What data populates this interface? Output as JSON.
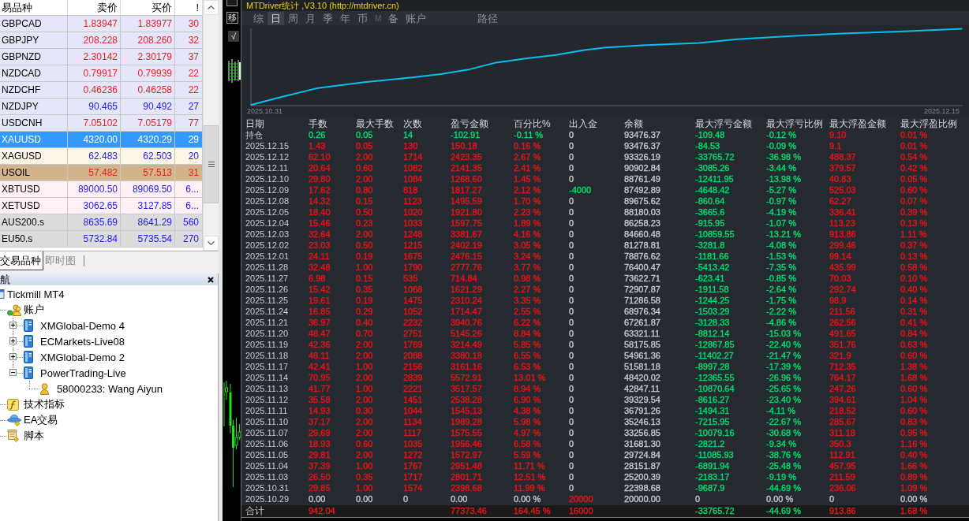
{
  "market_watch": {
    "columns": [
      "易品种",
      "卖价",
      "买价",
      "!"
    ],
    "rows": [
      {
        "symbol": "GBPCAD",
        "bid": "1.83947",
        "ask": "1.83977",
        "spread": "30",
        "rising": false,
        "color": "#e6e6fa",
        "selected": false
      },
      {
        "symbol": "GBPJPY",
        "bid": "208.228",
        "ask": "208.260",
        "spread": "32",
        "rising": false,
        "color": "#e6e6fa",
        "selected": false
      },
      {
        "symbol": "GBPNZD",
        "bid": "2.30142",
        "ask": "2.30179",
        "spread": "37",
        "rising": false,
        "color": "#e6e6fa",
        "selected": false
      },
      {
        "symbol": "NZDCAD",
        "bid": "0.79917",
        "ask": "0.79939",
        "spread": "22",
        "rising": false,
        "color": "#e6e6fa",
        "selected": false
      },
      {
        "symbol": "NZDCHF",
        "bid": "0.46236",
        "ask": "0.46258",
        "spread": "22",
        "rising": false,
        "color": "#e6e6fa",
        "selected": false
      },
      {
        "symbol": "NZDJPY",
        "bid": "90.465",
        "ask": "90.492",
        "spread": "27",
        "rising": true,
        "color": "#e6e6fa",
        "selected": false
      },
      {
        "symbol": "USDCNH",
        "bid": "7.05102",
        "ask": "7.05179",
        "spread": "77",
        "rising": false,
        "color": "#e6e6fa",
        "selected": false
      },
      {
        "symbol": "XAUUSD",
        "bid": "4320.00",
        "ask": "4320.29",
        "spread": "29",
        "selected": true
      },
      {
        "symbol": "XAGUSD",
        "bid": "62.483",
        "ask": "62.503",
        "spread": "20",
        "rising": true,
        "color": "#fdf5e6",
        "selected": false
      },
      {
        "symbol": "USOIL",
        "bid": "57.482",
        "ask": "57.513",
        "spread": "31",
        "rising": false,
        "color": "#d2b48c",
        "selected": false
      },
      {
        "symbol": "XBTUSD",
        "bid": "89000.50",
        "ask": "89069.50",
        "spread": "6...",
        "rising": true,
        "color": "#fff0f5",
        "selected": false
      },
      {
        "symbol": "XETUSD",
        "bid": "3062.65",
        "ask": "3127.85",
        "spread": "6...",
        "rising": true,
        "color": "#fff0f5",
        "selected": false
      },
      {
        "symbol": "AUS200.s",
        "bid": "8635.69",
        "ask": "8641.29",
        "spread": "560",
        "rising": true,
        "color": "#dcdcdc",
        "selected": false
      },
      {
        "symbol": "EU50.s",
        "bid": "5732.84",
        "ask": "5735.54",
        "spread": "270",
        "rising": true,
        "color": "#dcdcdc",
        "selected": false
      }
    ]
  },
  "panel_tabs": [
    {
      "label": "交易品种",
      "selected": true
    },
    {
      "label": "即时图",
      "selected": false
    }
  ],
  "navigator": {
    "title": "航",
    "tree": [
      {
        "label": "Tickmill MT4",
        "kind": "terminal",
        "children": [
          {
            "label": "账户",
            "kind": "accounts",
            "children": [
              {
                "label": "XMGlobal-Demo 4",
                "kind": "server",
                "expanded": false
              },
              {
                "label": "ECMarkets-Live08",
                "kind": "server",
                "expanded": false
              },
              {
                "label": "XMGlobal-Demo 2",
                "kind": "server",
                "expanded": false
              },
              {
                "label": "PowerTrading-Live",
                "kind": "server",
                "expanded": true,
                "children": [
                  {
                    "label": "58000233: Wang Aiyun",
                    "kind": "account"
                  }
                ]
              }
            ]
          },
          {
            "label": "技术指标",
            "kind": "indicators"
          },
          {
            "label": "EA交易",
            "kind": "experts"
          },
          {
            "label": "脚本",
            "kind": "scripts"
          }
        ]
      }
    ]
  },
  "chart_toolbar": [
    "移",
    "√"
  ],
  "stats": {
    "title": "MTDriver统计 ,V3.10 (http://mtdriver.cn)",
    "tabs": [
      {
        "label": "综",
        "selected": false,
        "disabled": false
      },
      {
        "label": "日",
        "selected": true,
        "disabled": false
      },
      {
        "label": "周",
        "selected": false,
        "disabled": false
      },
      {
        "label": "月",
        "selected": false,
        "disabled": false
      },
      {
        "label": "季",
        "selected": false,
        "disabled": false
      },
      {
        "label": "年",
        "selected": false,
        "disabled": false
      },
      {
        "label": "币",
        "selected": false,
        "disabled": false
      },
      {
        "label": "M",
        "selected": false,
        "disabled": true
      },
      {
        "label": "备",
        "selected": false,
        "disabled": false
      },
      {
        "label": "账户",
        "selected": false,
        "disabled": false
      }
    ],
    "path_button": "路径",
    "equity_chart": {
      "start_label": "2025.10.31",
      "end_label": "2025.12.15"
    },
    "table": {
      "columns": [
        {
          "label": "日期"
        },
        {
          "label": "手数",
          "color": "#f01414"
        },
        {
          "label": "最大手数",
          "color": "#f01414"
        },
        {
          "label": "次数",
          "color": "#f01414"
        },
        {
          "label": "盈亏金额",
          "color": "#f01414"
        },
        {
          "label": "百分比%",
          "color": "#f01414"
        },
        {
          "label": "出入金",
          "color": "#c4cad2"
        },
        {
          "label": "余额",
          "color": "#c4cad2"
        },
        {
          "label": "最大浮亏金额",
          "color": "#00e070"
        },
        {
          "label": "最大浮亏比例",
          "color": "#00e070"
        },
        {
          "label": "最大浮盈金额",
          "color": "#f01414"
        },
        {
          "label": "最大浮盈比例",
          "color": "#f01414"
        }
      ],
      "rows": [
        [
          "持仓",
          {
            "text": "0.26",
            "color": "#00e070"
          },
          {
            "text": "0.05",
            "color": "#00e070"
          },
          {
            "text": "14",
            "color": "#00e070"
          },
          {
            "text": "-102.91",
            "color": "#00e070"
          },
          {
            "text": "-0.11 %",
            "color": "#00e070"
          },
          "0",
          "93476.37",
          "-109.48",
          "-0.12 %",
          "9.10",
          "0.01 %"
        ],
        [
          "2025.12.15",
          "1.43",
          "0.05",
          "130",
          "150.18",
          "0.16 %",
          "0",
          "93476.37",
          "-84.53",
          "-0.09 %",
          "9.1",
          "0.01 %"
        ],
        [
          "2025.12.12",
          "62.10",
          "2.00",
          "1714",
          "2423.35",
          "2.67 %",
          "0",
          "93326.19",
          "-33765.72",
          "-36.98 %",
          "488.37",
          "0.54 %"
        ],
        [
          "2025.12.11",
          "20.64",
          "0.60",
          "1082",
          "2141.35",
          "2.41 %",
          "0",
          "90902.84",
          "-3085.26",
          "-3.44 %",
          "379.57",
          "0.42 %"
        ],
        [
          "2025.12.10",
          "29.80",
          "2.00",
          "1084",
          "1268.60",
          "1.45 %",
          "0",
          "88761.49",
          "-12411.95",
          "-13.98 %",
          "40.83",
          "0.05 %"
        ],
        [
          "2025.12.09",
          "17.62",
          "0.80",
          "818",
          "1817.27",
          "2.12 %",
          {
            "text": "-4000",
            "color": "#00e070"
          },
          "87492.89",
          "-4648.42",
          "-5.27 %",
          "525.03",
          "0.60 %"
        ],
        [
          "2025.12.08",
          "14.32",
          "0.15",
          "1123",
          "1495.59",
          "1.70 %",
          "0",
          "89675.62",
          "-860.64",
          "-0.97 %",
          "62.27",
          "0.07 %"
        ],
        [
          "2025.12.05",
          "18.40",
          "0.50",
          "1020",
          "1921.80",
          "2.23 %",
          "0",
          "88180.03",
          "-3665.6",
          "-4.19 %",
          "336.41",
          "0.39 %"
        ],
        [
          "2025.12.04",
          "15.46",
          "0.23",
          "1033",
          "1597.75",
          "1.89 %",
          "0",
          "86258.23",
          "-915.95",
          "-1.07 %",
          "113.23",
          "0.13 %"
        ],
        [
          "2025.12.03",
          "32.64",
          "2.00",
          "1248",
          "3381.67",
          "4.16 %",
          "0",
          "84660.48",
          "-10859.55",
          "-13.21 %",
          "913.86",
          "1.11 %"
        ],
        [
          "2025.12.02",
          "23.03",
          "0.50",
          "1215",
          "2402.19",
          "3.05 %",
          "0",
          "81278.81",
          "-3281.8",
          "-4.08 %",
          "299.46",
          "0.37 %"
        ],
        [
          "2025.12.01",
          "24.11",
          "0.19",
          "1675",
          "2476.15",
          "3.24 %",
          "0",
          "78876.62",
          "-1181.66",
          "-1.53 %",
          "99.14",
          "0.13 %"
        ],
        [
          "2025.11.28",
          "32.48",
          "1.00",
          "1790",
          "2777.76",
          "3.77 %",
          "0",
          "76400.47",
          "-5413.42",
          "-7.35 %",
          "435.99",
          "0.58 %"
        ],
        [
          "2025.11.27",
          "6.98",
          "0.15",
          "535",
          "714.84",
          "0.98 %",
          "0",
          "73622.71",
          "-623.41",
          "-0.85 %",
          "70.03",
          "0.10 %"
        ],
        [
          "2025.11.26",
          "15.42",
          "0.35",
          "1068",
          "1621.29",
          "2.27 %",
          "0",
          "72907.87",
          "-1911.58",
          "-2.64 %",
          "292.74",
          "0.40 %"
        ],
        [
          "2025.11.25",
          "19.61",
          "0.19",
          "1475",
          "2310.24",
          "3.35 %",
          "0",
          "71286.58",
          "-1244.25",
          "-1.75 %",
          "98.9",
          "0.14 %"
        ],
        [
          "2025.11.24",
          "16.85",
          "0.29",
          "1052",
          "1714.47",
          "2.55 %",
          "0",
          "68976.34",
          "-1503.29",
          "-2.22 %",
          "211.56",
          "0.31 %"
        ],
        [
          "2025.11.21",
          "36.97",
          "0.40",
          "2232",
          "3940.76",
          "6.22 %",
          "0",
          "67261.87",
          "-3128.33",
          "-4.86 %",
          "262.56",
          "0.41 %"
        ],
        [
          "2025.11.20",
          "48.47",
          "0.70",
          "2751",
          "5145.26",
          "8.84 %",
          "0",
          "63321.11",
          "-8812.14",
          "-15.03 %",
          "491.65",
          "0.84 %"
        ],
        [
          "2025.11.19",
          "42.36",
          "2.00",
          "1769",
          "3214.49",
          "5.85 %",
          "0",
          "58175.85",
          "-12867.85",
          "-22.40 %",
          "351.76",
          "0.63 %"
        ],
        [
          "2025.11.18",
          "48.11",
          "2.00",
          "2088",
          "3380.18",
          "6.55 %",
          "0",
          "54961.36",
          "-11402.27",
          "-21.47 %",
          "321.9",
          "0.60 %"
        ],
        [
          "2025.11.17",
          "42.41",
          "1.00",
          "2156",
          "3161.16",
          "6.53 %",
          "0",
          "51581.18",
          "-8997.28",
          "-17.39 %",
          "712.35",
          "1.38 %"
        ],
        [
          "2025.11.14",
          "70.95",
          "2.00",
          "2839",
          "5572.91",
          "13.01 %",
          "0",
          "48420.02",
          "-12365.55",
          "-26.96 %",
          "764.17",
          "1.68 %"
        ],
        [
          "2025.11.13",
          "41.77",
          "1.00",
          "2221",
          "3517.57",
          "8.94 %",
          "0",
          "42847.11",
          "-10870.64",
          "-25.65 %",
          "247.26",
          "0.60 %"
        ],
        [
          "2025.11.12",
          "35.58",
          "2.00",
          "1451",
          "2538.28",
          "6.90 %",
          "0",
          "39329.54",
          "-8616.27",
          "-23.40 %",
          "394.61",
          "1.04 %"
        ],
        [
          "2025.11.11",
          "14.93",
          "0.30",
          "1044",
          "1545.13",
          "4.38 %",
          "0",
          "36791.26",
          "-1494.31",
          "-4.11 %",
          "218.52",
          "0.60 %"
        ],
        [
          "2025.11.10",
          "37.17",
          "2.00",
          "1134",
          "1989.28",
          "5.98 %",
          "0",
          "35246.13",
          "-7215.95",
          "-22.67 %",
          "285.67",
          "0.83 %"
        ],
        [
          "2025.11.07",
          "29.69",
          "2.00",
          "1117",
          "1575.55",
          "4.97 %",
          "0",
          "33256.85",
          "-10079.16",
          "-30.68 %",
          "311.18",
          "0.95 %"
        ],
        [
          "2025.11.06",
          "18.93",
          "0.60",
          "1035",
          "1956.46",
          "6.58 %",
          "0",
          "31681.30",
          "-2821.2",
          "-9.34 %",
          "350.3",
          "1.16 %"
        ],
        [
          "2025.11.05",
          "29.81",
          "2.00",
          "1272",
          "1572.97",
          "5.59 %",
          "0",
          "29724.84",
          "-11085.93",
          "-38.76 %",
          "112.91",
          "0.40 %"
        ],
        [
          "2025.11.04",
          "37.39",
          "1.00",
          "1767",
          "2951.48",
          "11.71 %",
          "0",
          "28151.87",
          "-6891.94",
          "-25.48 %",
          "457.95",
          "1.66 %"
        ],
        [
          "2025.11.03",
          "26.50",
          "0.35",
          "1717",
          "2801.71",
          "12.51 %",
          "0",
          "25200.39",
          "-2183.17",
          "-9.19 %",
          "211.59",
          "0.89 %"
        ],
        [
          "2025.10.31",
          "29.85",
          "1.00",
          "1574",
          "2398.68",
          "11.99 %",
          "0",
          "22398.68",
          "-9687.9",
          "-44.69 %",
          "236.06",
          "1.09 %"
        ],
        [
          "2025.10.29",
          {
            "text": "0.00",
            "color": "#c4cad2"
          },
          {
            "text": "0.00",
            "color": "#c4cad2"
          },
          {
            "text": "0",
            "color": "#c4cad2"
          },
          {
            "text": "0.00",
            "color": "#c4cad2"
          },
          {
            "text": "0.00 %",
            "color": "#c4cad2"
          },
          {
            "text": "20000",
            "color": "#f01414"
          },
          "20000.00",
          {
            "text": "0",
            "color": "#c4cad2"
          },
          {
            "text": "0.00 %",
            "color": "#c4cad2"
          },
          {
            "text": "0",
            "color": "#c4cad2"
          },
          {
            "text": "0.00 %",
            "color": "#c4cad2"
          }
        ]
      ],
      "total": {
        "label": "合计",
        "lots": "942.04",
        "profit": "77373.46",
        "percent": "164.45 %",
        "deposits": {
          "text": "16000",
          "color": "#f01414"
        },
        "max_drawdown": "-33765.72",
        "max_drawdown_percent": "-44.69 %",
        "max_floating_profit": "913.86",
        "max_floating_profit_percent": "1.68 %"
      }
    }
  }
}
